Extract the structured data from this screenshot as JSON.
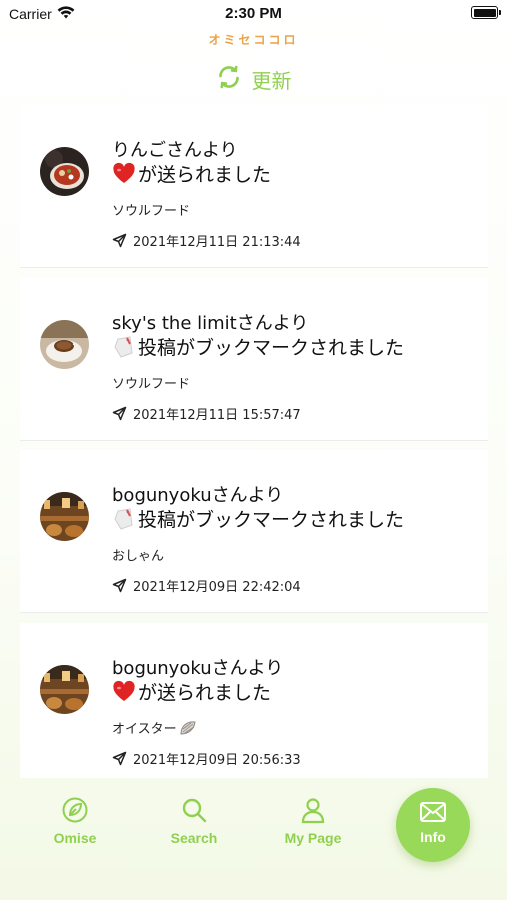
{
  "status_bar": {
    "carrier": "Carrier",
    "time": "2:30 PM"
  },
  "header": {
    "logo": "オミセココロ",
    "refresh_label": "更新"
  },
  "colors": {
    "accent": "#8fd14f",
    "logo": "#eba24a",
    "heart": "#e02424"
  },
  "notifications": [
    {
      "sender": "りんごさんより",
      "icon": "heart-icon",
      "message": "が送られました",
      "category": "ソウルフード",
      "timestamp": "2021年12月11日 21:13:44",
      "avatar": "food-bowl"
    },
    {
      "sender": "sky's the limitさんより",
      "icon": "bookmark-tag-icon",
      "message": "投稿がブックマークされました",
      "category": "ソウルフード",
      "timestamp": "2021年12月11日 15:57:47",
      "avatar": "coffee-cup"
    },
    {
      "sender": "bogunyokuさんより",
      "icon": "bookmark-tag-icon",
      "message": "投稿がブックマークされました",
      "category": "おしゃん",
      "timestamp": "2021年12月09日 22:42:04",
      "avatar": "cafe-interior"
    },
    {
      "sender": "bogunyokuさんより",
      "icon": "heart-icon",
      "message": "が送られました",
      "category": "オイスター",
      "category_icon": "oyster-icon",
      "timestamp": "2021年12月09日 20:56:33",
      "avatar": "cafe-interior"
    }
  ],
  "tabs": [
    {
      "label": "Omise",
      "icon": "shop-leaf-icon",
      "active": false
    },
    {
      "label": "Search",
      "icon": "search-icon",
      "active": false
    },
    {
      "label": "My Page",
      "icon": "person-icon",
      "active": false
    },
    {
      "label": "Info",
      "icon": "envelope-icon",
      "active": true
    }
  ]
}
